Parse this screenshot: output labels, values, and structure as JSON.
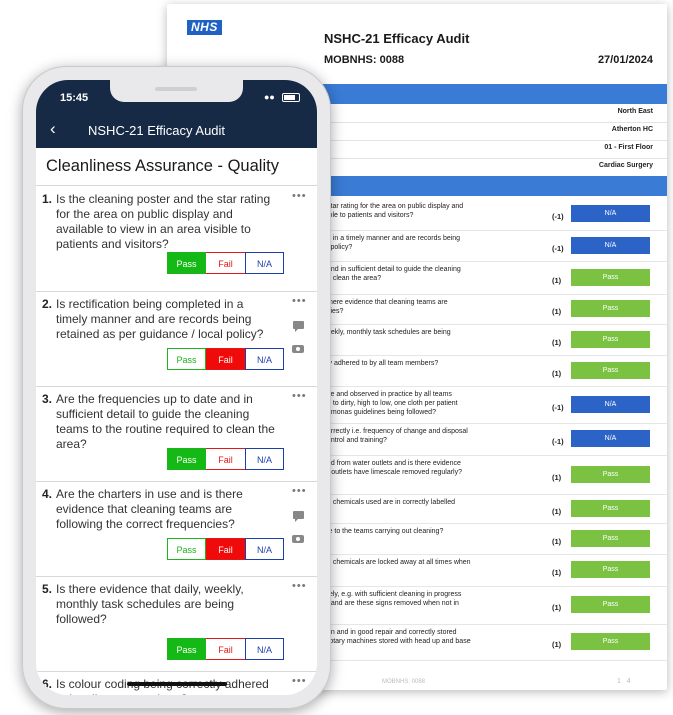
{
  "document": {
    "logo": "NHS",
    "title": "NSHC-21 Efficacy Audit",
    "ref": "MOBNHS: 0088",
    "date": "27/01/2024",
    "info": [
      "North East",
      "Atherton HC",
      "01 - First Floor",
      "Cardiac Surgery"
    ],
    "questions": [
      {
        "text": "star rating for the area on public display and\nible to patients and visitors?",
        "score": "(-1)",
        "result": "N/A"
      },
      {
        "text": "d in a timely manner and are records being\nl policy?",
        "score": "(-1)",
        "result": "N/A"
      },
      {
        "text": "and in sufficient detail to guide the cleaning\no clean the area?",
        "score": "(1)",
        "result": "Pass"
      },
      {
        "text": "there evidence that cleaning teams are\ncies?",
        "score": "(1)",
        "result": "Pass"
      },
      {
        "text": "eekly, monthly task schedules are being",
        "score": "(1)",
        "result": "Pass"
      },
      {
        "text": "ly adhered to by all team members?",
        "score": "(1)",
        "result": "Pass"
      },
      {
        "text": "ce and observed in practice by all teams\nn to dirty, high to low, one cloth per patient\nomonas guidelines being followed?",
        "score": "(-1)",
        "result": "N/A"
      },
      {
        "text": "orrectly i.e. frequency of change and disposal\nontrol and training?",
        "score": "(-1)",
        "result": "N/A"
      },
      {
        "text": "ed from water outlets and is there evidence\nr outlets have limescale removed regularly?",
        "score": "(1)",
        "result": "Pass"
      },
      {
        "text": "g chemicals used are in correctly labelled",
        "score": "(1)",
        "result": "Pass"
      },
      {
        "text": "le to the teams carrying out cleaning?",
        "score": "(1)",
        "result": "Pass"
      },
      {
        "text": "g chemicals are locked away at all times when",
        "score": "(1)",
        "result": "Pass"
      },
      {
        "text": "fely, e.g. with sufficient cleaning in progress\n, and are these signs removed when not in",
        "score": "(1)",
        "result": "Pass"
      },
      {
        "text": "an and in good repair and correctly stored\nrotary machines stored with head up and base",
        "score": "(1)",
        "result": "Pass"
      }
    ],
    "footer": "MOBNHS: 0088",
    "page_current": "1",
    "page_total": "4"
  },
  "phone": {
    "time": "15:45",
    "nav_title": "NSHC-21 Efficacy Audit",
    "section_title": "Cleanliness Assurance - Quality",
    "button_labels": {
      "pass": "Pass",
      "fail": "Fail",
      "na": "N/A"
    },
    "questions": [
      {
        "num": "1.",
        "text": "Is the cleaning poster and the star rating for the area on public display and available to view in an area visible to patients and visitors?",
        "selected": "pass",
        "has_attachments": false
      },
      {
        "num": "2.",
        "text": "Is rectification being completed in a timely manner and are records being retained as per guidance / local policy?",
        "selected": "fail",
        "has_attachments": true
      },
      {
        "num": "3.",
        "text": "Are the frequencies up to date and in sufficient detail to guide the cleaning teams to the routine required to clean the area?",
        "selected": "pass",
        "has_attachments": false
      },
      {
        "num": "4.",
        "text": "Are the charters in use and is there evidence that cleaning teams are following the correct frequencies?",
        "selected": "fail",
        "has_attachments": true
      },
      {
        "num": "5.",
        "text": "Is there evidence that daily, weekly, monthly task schedules are being followed?",
        "selected": "pass",
        "has_attachments": false
      },
      {
        "num": "6.",
        "text": "Is colour coding being correctly adhered to by all team members?",
        "selected": "",
        "has_attachments": false
      }
    ]
  },
  "colors": {
    "navy": "#172a45",
    "pass": "#15b915",
    "fail": "#f00a0a",
    "na_blue": "#2c63c6",
    "doc_pass": "#7cc242",
    "doc_header": "#3a7bd5"
  }
}
